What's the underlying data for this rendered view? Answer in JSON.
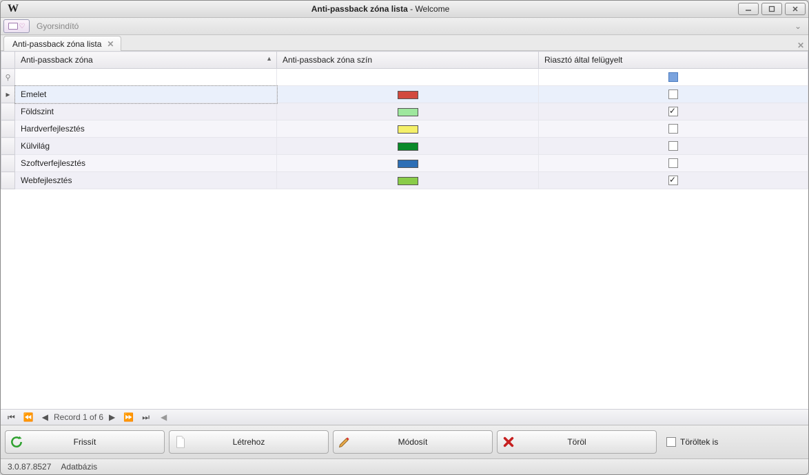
{
  "window": {
    "title_main": "Anti-passback zóna lista",
    "title_suffix": " - Welcome",
    "logo_text": "W"
  },
  "ribbon": {
    "quick_launch_label": "Gyorsindító"
  },
  "tab": {
    "label": "Anti-passback zóna lista"
  },
  "columns": {
    "indicator": "",
    "zone": "Anti-passback zóna",
    "zone_sorted_asc": true,
    "color": "Anti-passback zóna szín",
    "alarm": "Riasztó által felügyelt"
  },
  "filter_row": {
    "alarm_indeterminate": true
  },
  "rows": [
    {
      "selected": true,
      "zone": "Emelet",
      "color": "#d24a3e",
      "alarm": false,
      "alt": false
    },
    {
      "selected": false,
      "zone": "Földszint",
      "color": "#9ee79e",
      "alarm": true,
      "alt": true
    },
    {
      "selected": false,
      "zone": "Hardverfejlesztés",
      "color": "#f5f06a",
      "alarm": false,
      "alt": false
    },
    {
      "selected": false,
      "zone": "Külvilág",
      "color": "#0a8a2a",
      "alarm": false,
      "alt": true
    },
    {
      "selected": false,
      "zone": "Szoftverfejlesztés",
      "color": "#2e6fb5",
      "alarm": false,
      "alt": false
    },
    {
      "selected": false,
      "zone": "Webfejlesztés",
      "color": "#8acc4a",
      "alarm": true,
      "alt": true
    }
  ],
  "navigator": {
    "text": "Record 1 of 6"
  },
  "buttons": {
    "refresh": "Frissít",
    "create": "Létrehoz",
    "modify": "Módosít",
    "delete": "Töröl",
    "deleted_too": "Töröltek is"
  },
  "status": {
    "version": "3.0.87.8527",
    "db": "Adatbázis"
  },
  "icons": {
    "sort_asc": "▲"
  }
}
